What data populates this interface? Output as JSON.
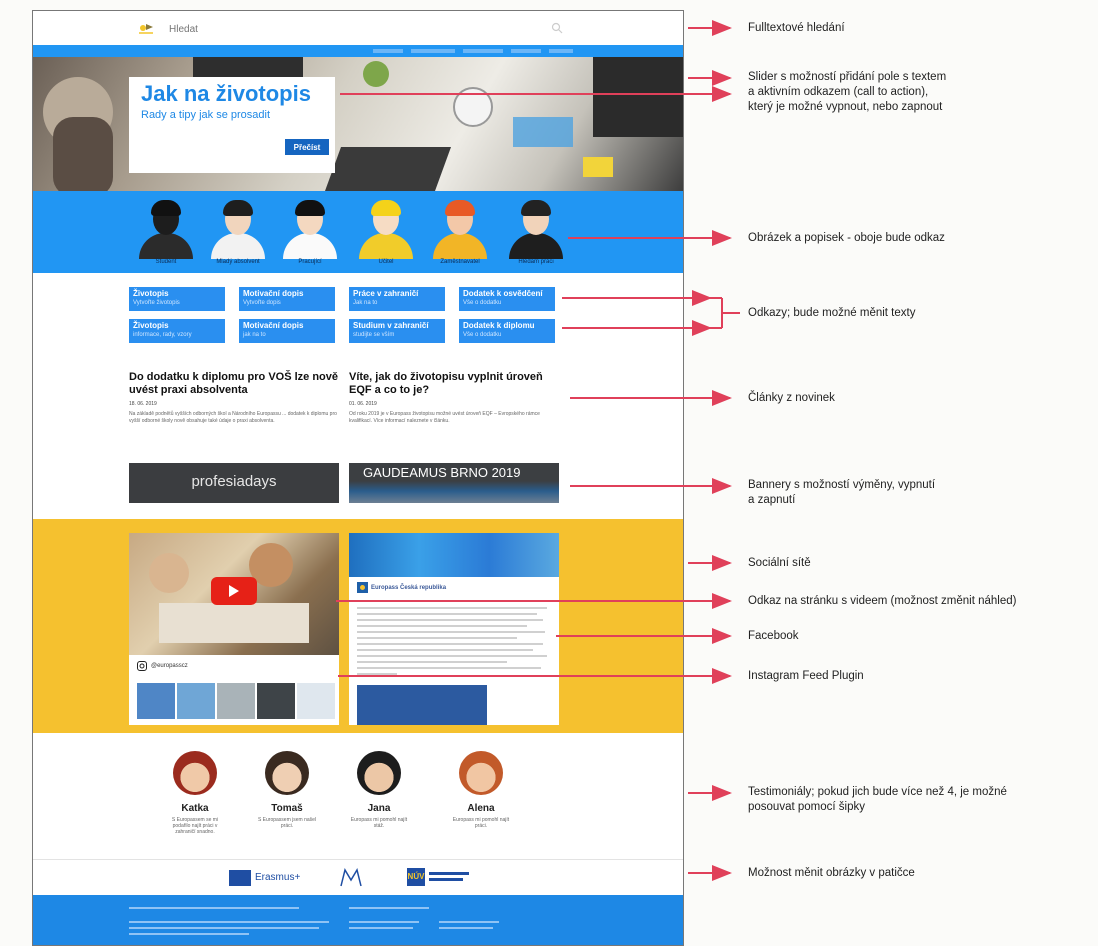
{
  "mockup": {
    "search": {
      "placeholder": "Hledat"
    },
    "slider": {
      "title_prefix": "Jak na ",
      "title_bold": "životopis",
      "subtitle": "Rady a tipy jak se prosadit",
      "cta": "Přečíst"
    },
    "people": [
      {
        "label": "Student",
        "skin": "#1d1d1d",
        "hair": "#111111",
        "shirt": "#2b2b2b"
      },
      {
        "label": "Mladý absolvent",
        "skin": "#f1d5bd",
        "hair": "#1e1e1e",
        "shirt": "#f2f2f2"
      },
      {
        "label": "Pracující",
        "skin": "#f4d8c0",
        "hair": "#111111",
        "shirt": "#fafafa"
      },
      {
        "label": "Učitel",
        "skin": "#f6dcc4",
        "hair": "#f4d21a",
        "shirt": "#f1cc2a"
      },
      {
        "label": "Zaměstnavatel",
        "skin": "#f3c8a8",
        "hair": "#e85a26",
        "shirt": "#f2b526"
      },
      {
        "label": "Hledám práci",
        "skin": "#f1d3ba",
        "hair": "#222222",
        "shirt": "#1e1e1e"
      }
    ],
    "links": [
      {
        "line1": "Životopis",
        "line2": "Vytvořte životopis"
      },
      {
        "line1": "Motivační dopis",
        "line2": "Vytvořte dopis"
      },
      {
        "line1": "Práce v zahraničí",
        "line2": "Jak na to"
      },
      {
        "line1": "Dodatek k osvědčení",
        "line2": "Vše o dodatku"
      },
      {
        "line1": "Životopis",
        "line2": "informace, rady, vzory"
      },
      {
        "line1": "Motivační dopis",
        "line2": "jak na to"
      },
      {
        "line1": "Studium v zahraničí",
        "line2": "studijte se vším"
      },
      {
        "line1": "Dodatek k diplomu",
        "line2": "Vše o dodatku"
      }
    ],
    "articles": [
      {
        "title": "Do dodatku k diplomu pro VOŠ lze nově uvést praxi absolventa",
        "date": "18. 06. 2019",
        "text": "Na základě podnětů vyšších odborných škol a Národního Europassu ... dodatek k diplomu pro vyšší odborné školy nově obsahuje také údaje o praxi absolventa."
      },
      {
        "title": "Víte, jak do životopisu vyplnit úroveň EQF a co to je?",
        "date": "01. 06. 2019",
        "text": "Od roku 2019 je v Europass životopisu možné uvést úroveň EQF – Evropského rámce kvalifikací. Více informací naleznete v článku."
      }
    ],
    "banners": [
      {
        "text": "profesiadays"
      },
      {
        "text": "GAUDEAMUS BRNO 2019"
      }
    ],
    "instagram": {
      "handle": "@europasscz"
    },
    "facebook": {
      "page": "Europass Česká republika"
    },
    "testimonials": [
      {
        "name": "Katka",
        "quote": "S Europassem se mi podařilo najít práci v zahraničí snadno.",
        "skin": "#f0c9a8",
        "hair": "#9b2b1e"
      },
      {
        "name": "Tomaš",
        "quote": "S Europassem jsem našel práci.",
        "skin": "#efcfb3",
        "hair": "#3a2a20"
      },
      {
        "name": "Jana",
        "quote": "Europass mi pomohl najít stáž.",
        "skin": "#ecc7a6",
        "hair": "#1d1d1d"
      },
      {
        "name": "Alena",
        "quote": "Europass mi pomohl najít práci.",
        "skin": "#f1c6a3",
        "hair": "#c25a2a"
      }
    ],
    "logos": [
      {
        "text": "Erasmus+"
      },
      {
        "text": "NÚV"
      }
    ]
  },
  "annotations": [
    {
      "lines": [
        "Fulltextové hledání"
      ]
    },
    {
      "lines": [
        "Slider s možností přidání pole s textem",
        "a aktivním odkazem (call to action),",
        "který je možné vypnout, nebo zapnout"
      ]
    },
    {
      "lines": [
        "Obrázek a popisek - oboje bude odkaz"
      ]
    },
    {
      "lines": [
        "Odkazy; bude možné měnit texty"
      ]
    },
    {
      "lines": [
        "Články z novinek"
      ]
    },
    {
      "lines": [
        "Bannery s možností výměny, vypnutí",
        "a zapnutí"
      ]
    },
    {
      "lines": [
        "Sociální sítě"
      ]
    },
    {
      "lines": [
        "Odkaz na stránku s videem (možnost změnit náhled)"
      ]
    },
    {
      "lines": [
        "Facebook"
      ]
    },
    {
      "lines": [
        "Instagram Feed Plugin"
      ]
    },
    {
      "lines": [
        "Testimoniály; pokud jich bude více než 4, je možné",
        "posouvat pomocí šipky"
      ]
    },
    {
      "lines": [
        "Možnost měnit obrázky v patičce"
      ]
    }
  ],
  "colors": {
    "arrow": "#e0405a",
    "primary_blue": "#2196f3",
    "social_yellow": "#f5c12f"
  }
}
